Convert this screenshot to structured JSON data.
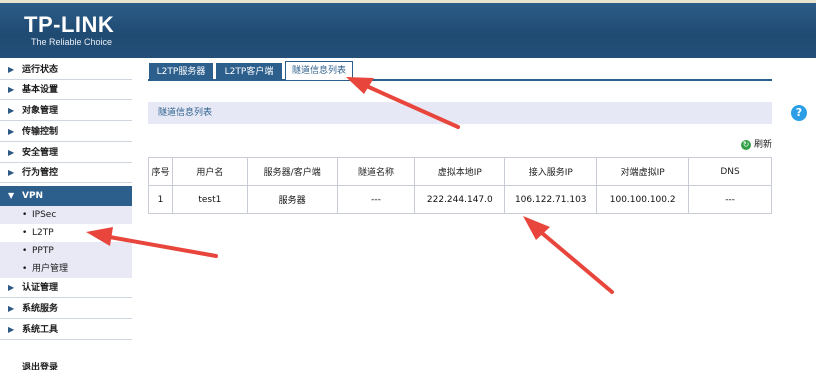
{
  "brand": {
    "logo": "TP-LINK",
    "tagline": "The Reliable Choice"
  },
  "sidebar": {
    "items": [
      {
        "label": "运行状态"
      },
      {
        "label": "基本设置"
      },
      {
        "label": "对象管理"
      },
      {
        "label": "传输控制"
      },
      {
        "label": "安全管理"
      },
      {
        "label": "行为管控"
      }
    ],
    "vpn": {
      "label": "VPN",
      "subitems": [
        {
          "label": "IPSec"
        },
        {
          "label": "L2TP"
        },
        {
          "label": "PPTP"
        },
        {
          "label": "用户管理"
        }
      ]
    },
    "items_after": [
      {
        "label": "认证管理"
      },
      {
        "label": "系统服务"
      },
      {
        "label": "系统工具"
      }
    ],
    "logout": "退出登录"
  },
  "tabs": [
    {
      "label": "L2TP服务器"
    },
    {
      "label": "L2TP客户端"
    },
    {
      "label": "隧道信息列表"
    }
  ],
  "section": {
    "title": "隧道信息列表"
  },
  "help": {
    "label": "?"
  },
  "refresh": {
    "label": "刷新"
  },
  "table": {
    "headers": [
      "序号",
      "用户名",
      "服务器/客户端",
      "隧道名称",
      "虚拟本地IP",
      "接入服务IP",
      "对端虚拟IP",
      "DNS"
    ],
    "rows": [
      [
        "1",
        "test1",
        "服务器",
        "---",
        "222.244.147.0",
        "106.122.71.103",
        "100.100.100.2",
        "---"
      ]
    ]
  },
  "colors": {
    "header": "#244f78",
    "accent": "#2c5f8c",
    "arrow": "#e8463c",
    "help": "#2a9ee6",
    "refresh": "#33a047"
  }
}
